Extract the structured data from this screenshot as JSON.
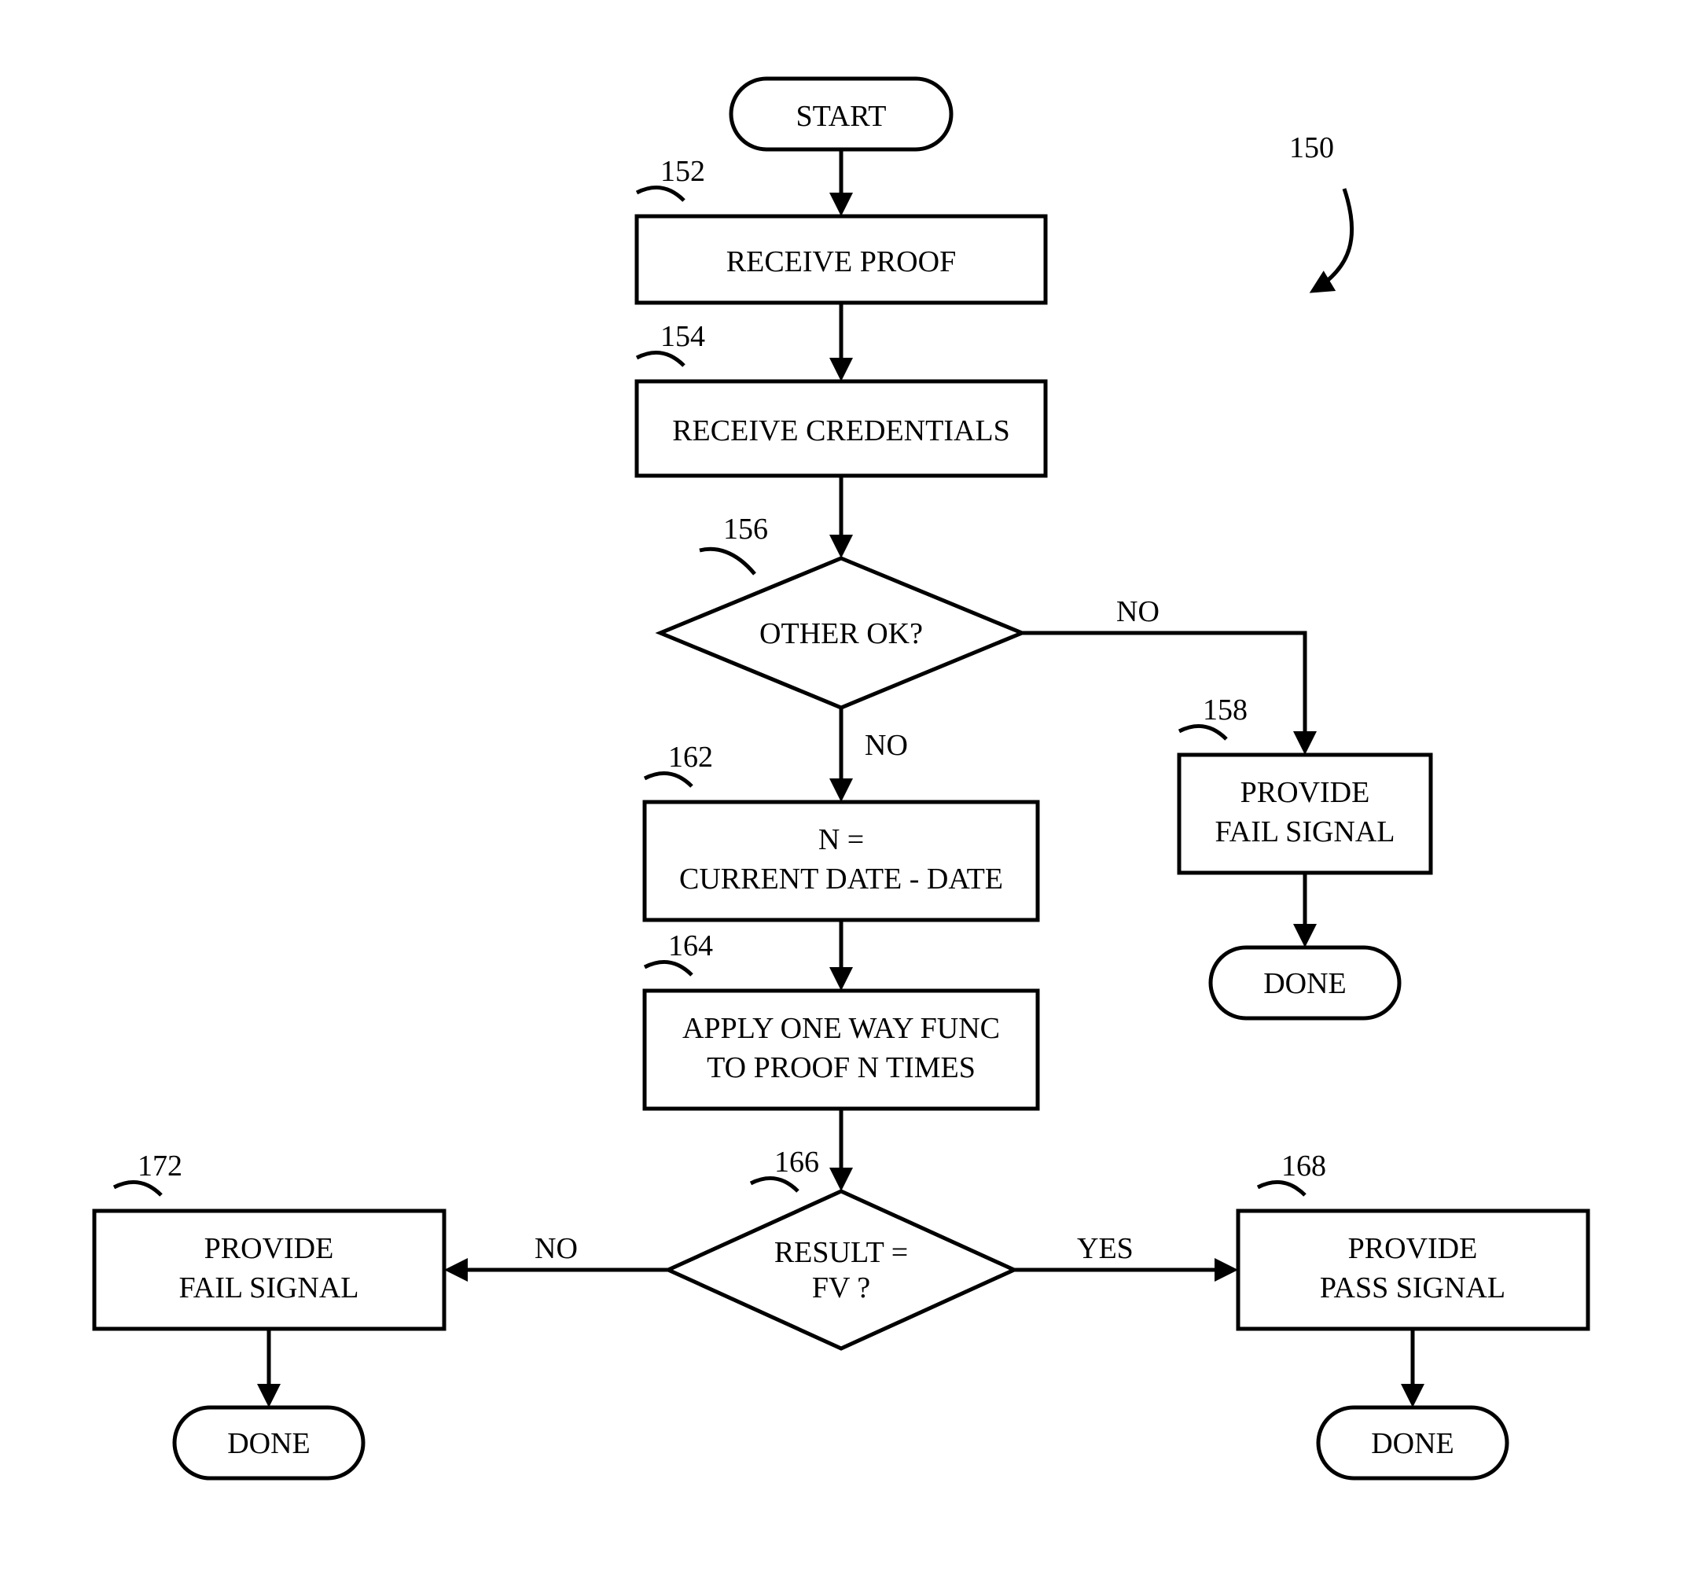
{
  "figure_ref": "150",
  "nodes": {
    "start": {
      "label": "START"
    },
    "n152": {
      "ref": "152",
      "label": "RECEIVE  PROOF"
    },
    "n154": {
      "ref": "154",
      "label": "RECEIVE CREDENTIALS"
    },
    "n156": {
      "ref": "156",
      "label": "OTHER OK?"
    },
    "n158": {
      "ref": "158",
      "label1": "PROVIDE",
      "label2": "FAIL SIGNAL"
    },
    "n162": {
      "ref": "162",
      "label1": "N =",
      "label2": "CURRENT DATE - DATE"
    },
    "n164": {
      "ref": "164",
      "label1": "APPLY ONE WAY FUNC",
      "label2": "TO PROOF N TIMES"
    },
    "n166": {
      "ref": "166",
      "label1": "RESULT =",
      "label2": "FV ?"
    },
    "n168": {
      "ref": "168",
      "label1": "PROVIDE",
      "label2": "PASS SIGNAL"
    },
    "n172": {
      "ref": "172",
      "label1": "PROVIDE",
      "label2": "FAIL SIGNAL"
    },
    "done1": {
      "label": "DONE"
    },
    "done2": {
      "label": "DONE"
    },
    "done3": {
      "label": "DONE"
    }
  },
  "edges": {
    "no1": "NO",
    "no2": "NO",
    "no3": "NO",
    "yes": "YES"
  }
}
